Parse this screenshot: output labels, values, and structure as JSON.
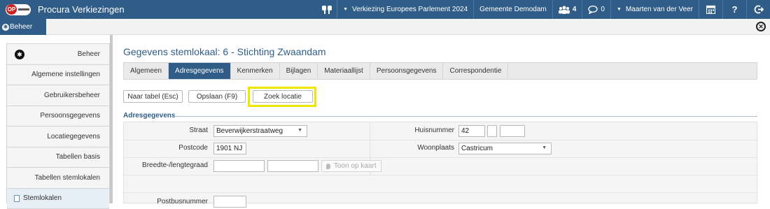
{
  "app": {
    "title": "Procura Verkiezingen",
    "logo_letters": "OP"
  },
  "topbar": {
    "election": "Verkiezing Europees Parlement 2024",
    "municipality": "Gemeente Demodam",
    "users_count": "4",
    "messages_count": "0",
    "user_name": "Maarten van der Veer",
    "help_label": "?"
  },
  "subbar": {
    "tab_label": "Beheer"
  },
  "sidebar": {
    "items": [
      {
        "label": "Beheer"
      },
      {
        "label": "Algemene instellingen"
      },
      {
        "label": "Gebruikersbeheer"
      },
      {
        "label": "Persoonsgegevens"
      },
      {
        "label": "Locatiegegevens"
      },
      {
        "label": "Tabellen basis"
      },
      {
        "label": "Tabellen stemlokalen"
      },
      {
        "label": "Stemlokalen"
      }
    ]
  },
  "main": {
    "page_title": "Gegevens stemlokaal: 6 - Stichting Zwaandam",
    "tabs": [
      {
        "label": "Algemeen"
      },
      {
        "label": "Adresgegevens"
      },
      {
        "label": "Kenmerken"
      },
      {
        "label": "Bijlagen"
      },
      {
        "label": "Materiaallijst"
      },
      {
        "label": "Persoonsgegevens"
      },
      {
        "label": "Correspondentie"
      }
    ],
    "buttons": {
      "back": "Naar tabel (Esc)",
      "save": "Opslaan (F9)",
      "find_location": "Zoek locatie"
    },
    "section_title": "Adresgegevens",
    "form": {
      "street_label": "Straat",
      "street_value": "Beverwijkerstraatweg",
      "housenumber_label": "Huisnummer",
      "housenumber_value": "42",
      "housenumber_letter": "",
      "housenumber_addition": "",
      "postcode_label": "Postcode",
      "postcode_value": "1901 NJ",
      "city_label": "Woonplaats",
      "city_value": "Castricum",
      "latlon_label": "Breedte-/lengtegraad",
      "lat_value": "",
      "lon_value": "",
      "map_button": "Toon op kaart",
      "pobox_label": "Postbusnummer",
      "pobox_value": ""
    }
  },
  "colors": {
    "brand": "#2f5d87",
    "highlight": "#f0e600"
  }
}
